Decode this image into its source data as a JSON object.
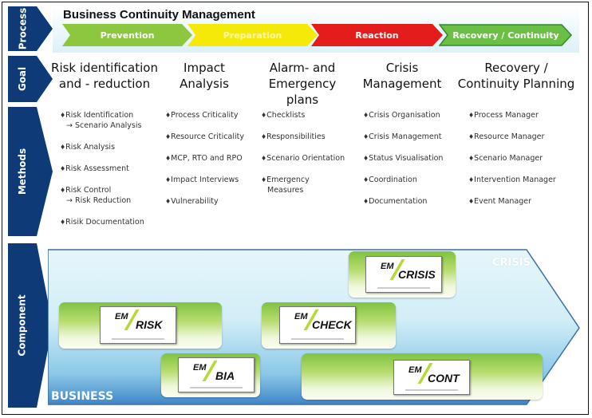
{
  "title": "Business Continuity Management",
  "rows": {
    "process": "Process",
    "goal": "Goal",
    "methods": "Methods",
    "component": "Component"
  },
  "phases": [
    {
      "label": "Prevention",
      "color": "#8dc63f"
    },
    {
      "label": "Preparation",
      "color": "#f5e90a"
    },
    {
      "label": "Reaction",
      "color": "#e51c1c"
    },
    {
      "label": "Recovery / Continuity",
      "color": "#6cbf45"
    }
  ],
  "goals": [
    {
      "line1": "Risk identification",
      "line2": "and - reduction"
    },
    {
      "line1": "Impact",
      "line2": "Analysis"
    },
    {
      "line1": "Alarm- and",
      "line2": "Emergency plans"
    },
    {
      "line1": "Crisis",
      "line2": "Management"
    },
    {
      "line1": "Recovery /",
      "line2": "Continuity Planning"
    }
  ],
  "methods": [
    [
      {
        "text": "Risk Identification",
        "sub": "→ Scenario Analysis"
      },
      {
        "text": "Risk Analysis"
      },
      {
        "text": "Risk Assessment"
      },
      {
        "text": "Risk Control",
        "sub": "→ Risk Reduction"
      },
      {
        "text": "Risik Documentation"
      }
    ],
    [
      {
        "text": "Process Criticality"
      },
      {
        "text": "Resource Criticality"
      },
      {
        "text": "MCP, RTO and RPO"
      },
      {
        "text": "Impact Interviews"
      },
      {
        "text": "Vulnerability"
      }
    ],
    [
      {
        "text": "Checklists"
      },
      {
        "text": "Responsibilities"
      },
      {
        "text": "Scenario Orientation"
      },
      {
        "text": "Emergency",
        "sub": "Measures"
      }
    ],
    [
      {
        "text": "Crisis Organisation"
      },
      {
        "text": "Crisis Management"
      },
      {
        "text": "Status Visualisation"
      },
      {
        "text": "Coordination"
      },
      {
        "text": "Documentation"
      }
    ],
    [
      {
        "text": "Process Manager"
      },
      {
        "text": "Resource Manager"
      },
      {
        "text": "Scenario Manager"
      },
      {
        "text": "Intervention Manager"
      },
      {
        "text": "Event Manager"
      }
    ]
  ],
  "bullet": "♦",
  "components": {
    "prefix": "EM",
    "risk": "RISK",
    "bia": "BIA",
    "check": "CHECK",
    "crisis": "CRISIS",
    "cont": "CONT"
  },
  "zones": {
    "crisis": "CRISIS",
    "business": "BUSINESS"
  },
  "colors": {
    "navy": "#0e3a78",
    "lime": "#b5d935"
  }
}
